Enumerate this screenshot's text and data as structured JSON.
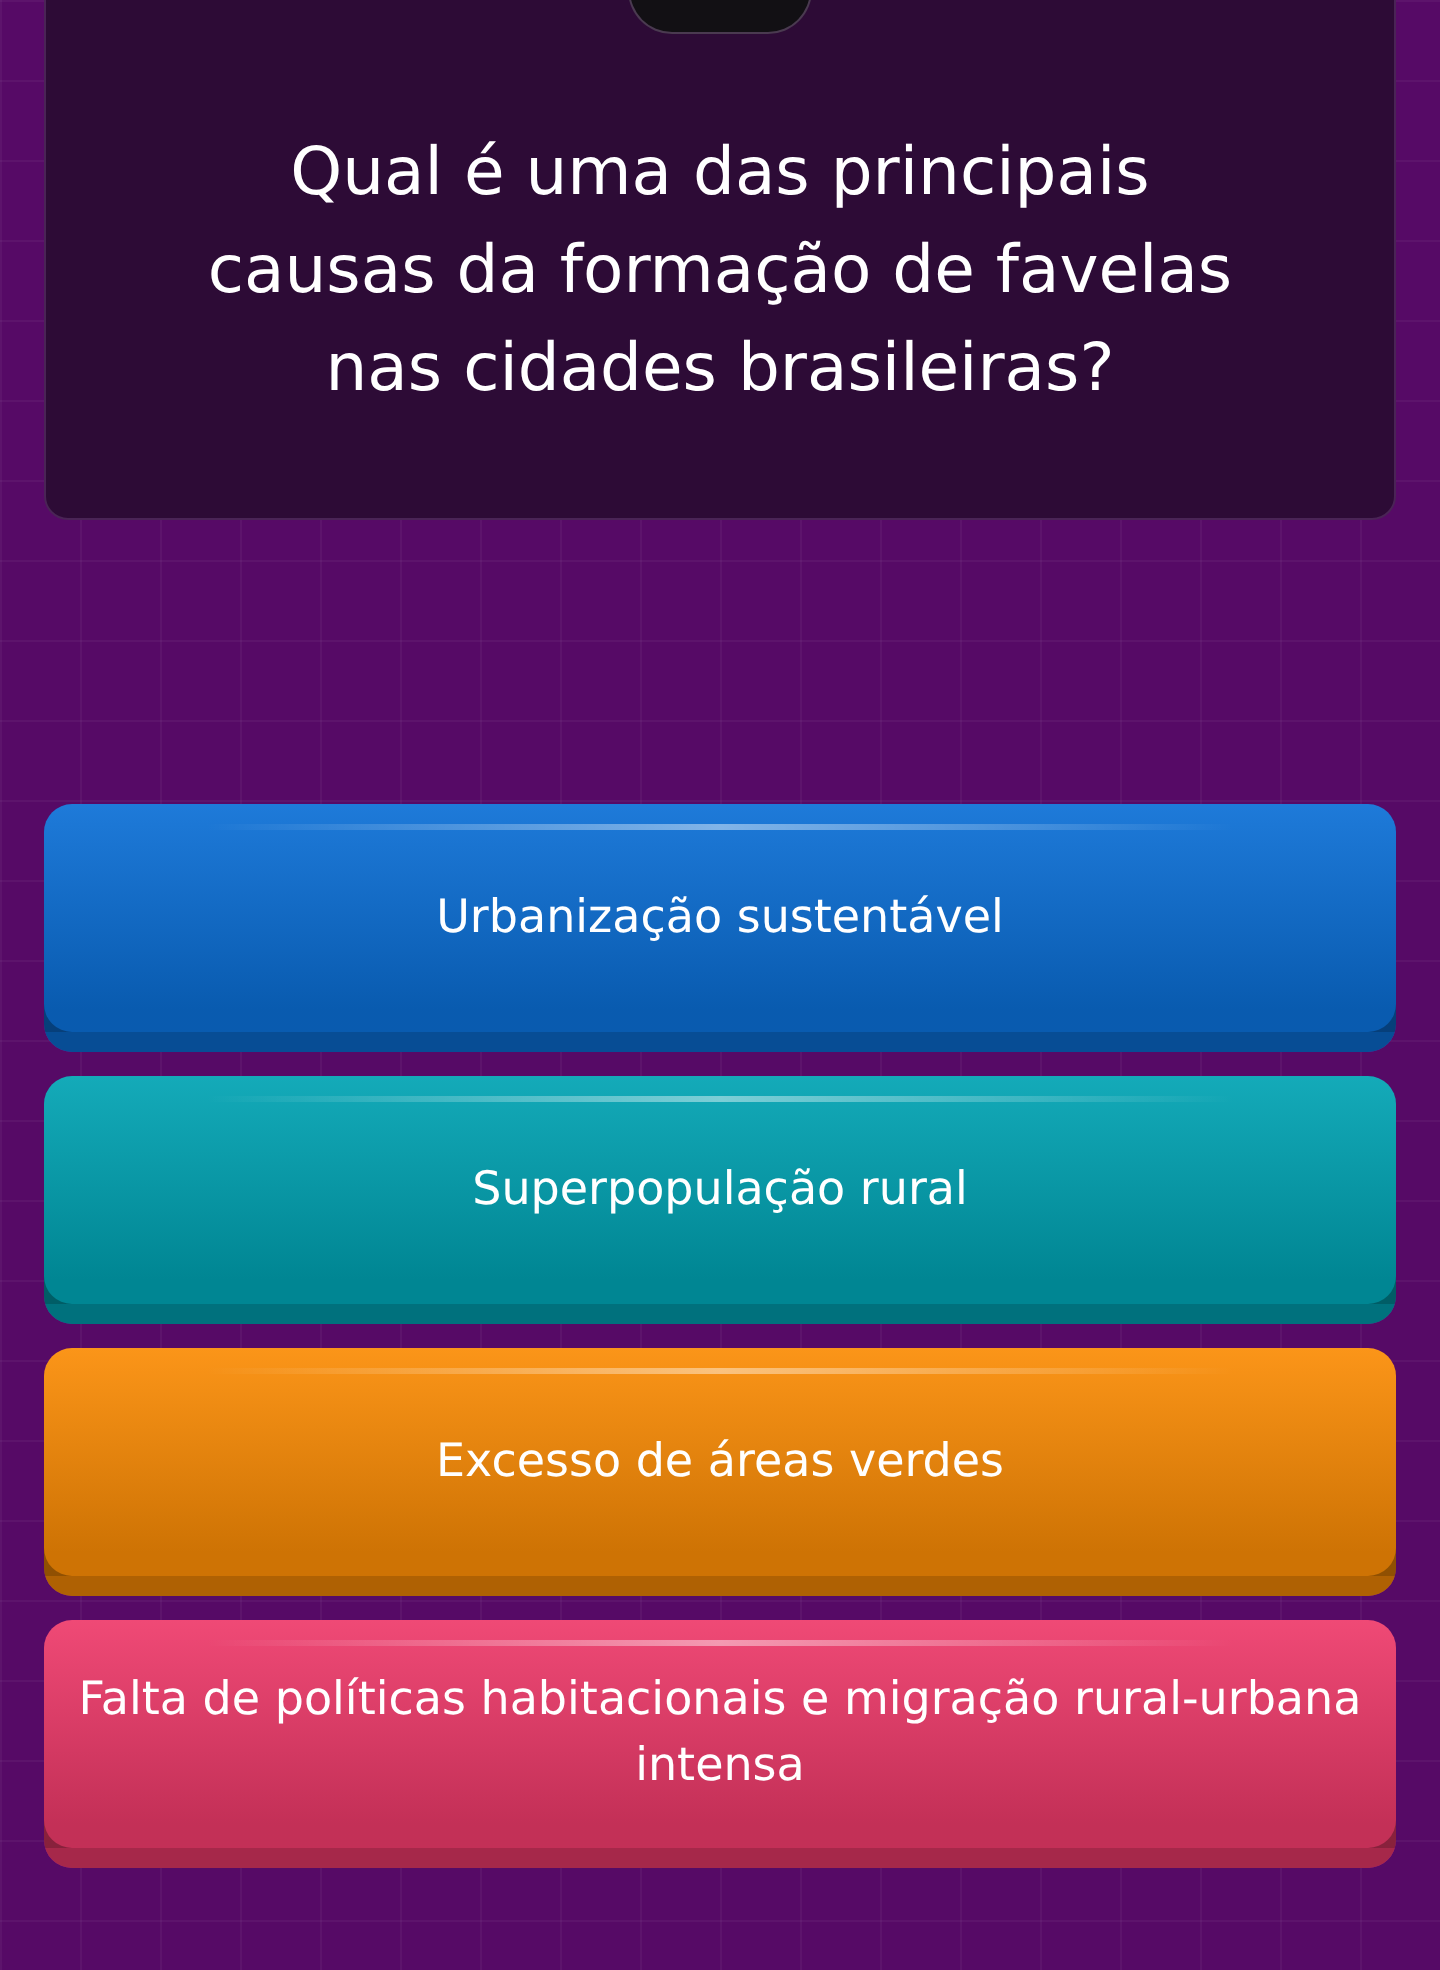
{
  "question": {
    "text": "Qual é uma das principais causas da formação de favelas nas cidades brasileiras?"
  },
  "answers": [
    {
      "text": "Urbanização sustentável",
      "color": "#0b6fd6"
    },
    {
      "text": "Superpopulação rural",
      "color": "#00a3b3"
    },
    {
      "text": "Excesso de áreas verdes",
      "color": "#fb8c05"
    },
    {
      "text": "Falta de políticas habitacionais e migração rural-urbana intensa",
      "color": "#ee3a6a"
    }
  ]
}
